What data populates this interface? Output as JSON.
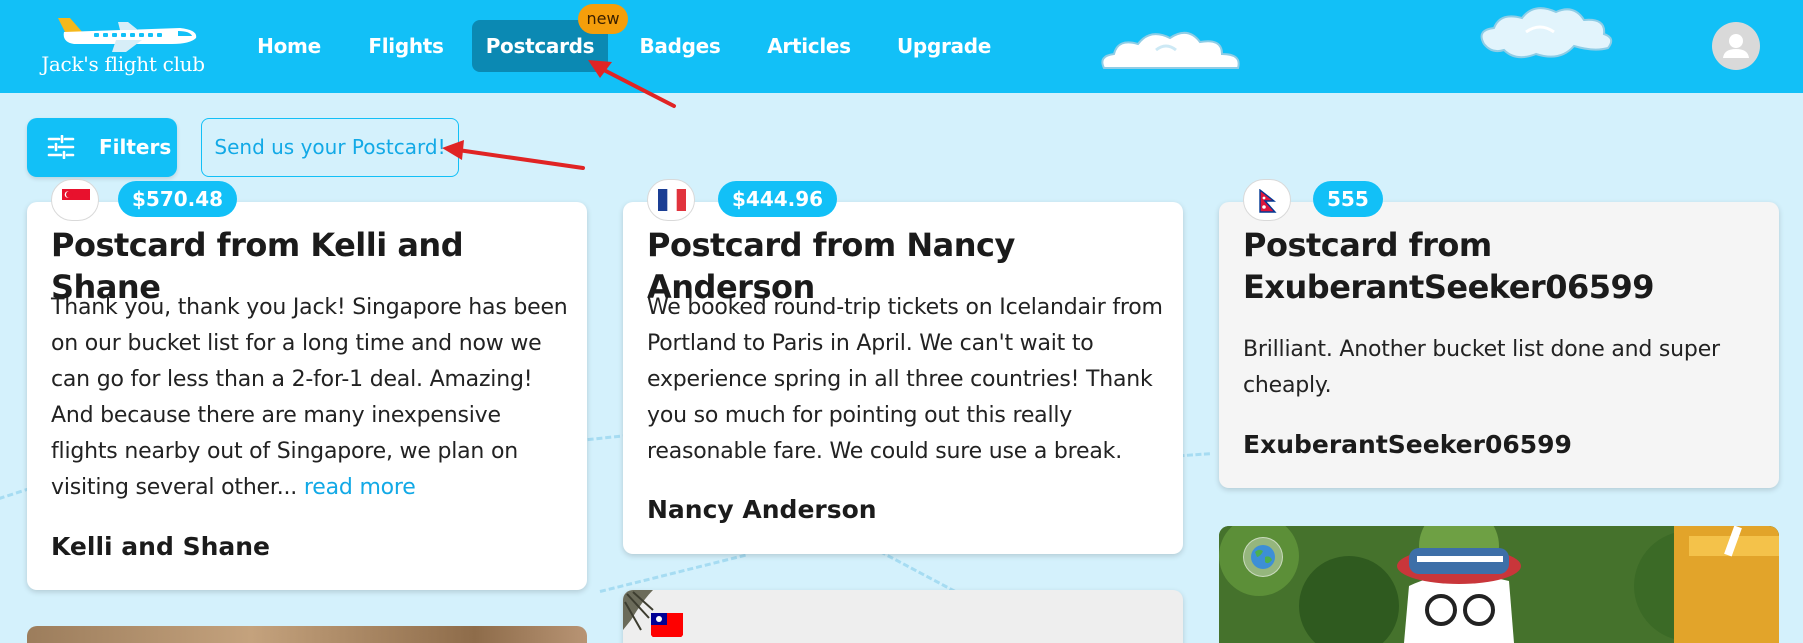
{
  "header": {
    "logo_text": "Jack's flight club",
    "nav": [
      {
        "label": "Home"
      },
      {
        "label": "Flights"
      },
      {
        "label": "Postcards"
      },
      {
        "label": "Badges"
      },
      {
        "label": "Articles"
      },
      {
        "label": "Upgrade"
      }
    ],
    "new_badge": "new"
  },
  "toolbar": {
    "filters_label": "Filters",
    "send_postcard_label": "Send us your Postcard!"
  },
  "cards": [
    {
      "price": "$570.48",
      "flag": "Singapore",
      "title": "Postcard from Kelli and Shane",
      "body": "Thank you, thank you Jack! Singapore has been on our bucket list for a long time and now we can go for less than a 2-for-1 deal. Amazing! And because there are many inexpensive flights nearby out of Singapore, we plan on visiting several other...",
      "read_more": "read more",
      "author": "Kelli and Shane"
    },
    {
      "price": "$444.96",
      "flag": "France",
      "title": "Postcard from Nancy Anderson",
      "body": "We booked round-trip tickets on Icelandair from Portland to Paris in April. We can't wait to experience spring in all three countries! Thank you so much for pointing out this really reasonable fare. We could sure use a break.",
      "author": "Nancy Anderson"
    },
    {
      "price": "555",
      "flag": "Nepal",
      "title": "Postcard from ExuberantSeeker06599",
      "body": "Brilliant. Another bucket list done and super cheaply.",
      "author": "ExuberantSeeker06599"
    }
  ],
  "lower_cards": [
    {
      "flag": "Taiwan"
    },
    {
      "flag": "Earth"
    }
  ],
  "colors": {
    "brand": "#12c0f7",
    "active_nav": "#0b89b3",
    "badge": "#f59e0b",
    "page_bg": "#d4f1fc",
    "link": "#12a9e6"
  }
}
